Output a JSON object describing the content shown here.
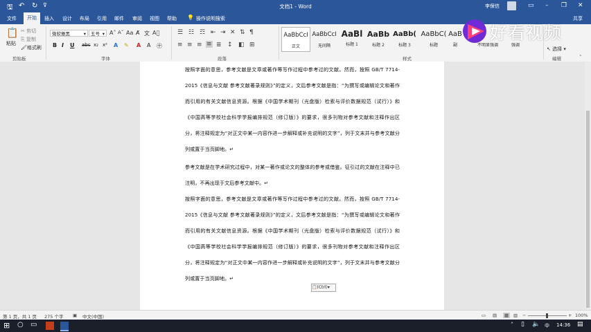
{
  "window": {
    "title": "文档1 - Word",
    "user": "李保信",
    "share": "共享"
  },
  "tabs": [
    "文件",
    "开始",
    "插入",
    "设计",
    "布局",
    "引用",
    "邮件",
    "审阅",
    "视图",
    "帮助"
  ],
  "tell_me": "操作说明搜索",
  "clipboard": {
    "paste": "粘贴",
    "cut": "剪切",
    "copy": "复制",
    "format_painter": "格式刷",
    "group": "剪贴板"
  },
  "font": {
    "name": "微软雅黑",
    "size": "五号",
    "group": "字体"
  },
  "paragraph": {
    "group": "段落"
  },
  "styles": {
    "items": [
      {
        "sample": "AaBbCcI",
        "name": "正文"
      },
      {
        "sample": "AaBbCcI",
        "name": "无间隔"
      },
      {
        "sample": "AaBl",
        "name": "标题 1"
      },
      {
        "sample": "AaBb",
        "name": "标题 2"
      },
      {
        "sample": "AaBb(",
        "name": "标题 3"
      },
      {
        "sample": "AaBbC(",
        "name": "标题"
      },
      {
        "sample": "AaB",
        "name": "副"
      },
      {
        "sample": "",
        "name": "不明显强调"
      },
      {
        "sample": "",
        "name": "强调"
      }
    ],
    "group": "样式"
  },
  "editing": {
    "select": "选择",
    "group": "编辑"
  },
  "document": {
    "paragraphs": [
      "按照字面的意思，参考文献是文章或著作等写作过程中参考过的文献。然而，按照 GB/T 7714-2015《信息与文献 参考文献著录规则》”的定义，文后参考文献是指：“为撰写或编辑论文和著作而引用的有关文献信息资源。根据《中国学术期刊（光盘版）检索与评价数据规范（试行）》和《中国高等学校社会科学学报编排规范（修订版）》的要求，很多刊物对参考文献和注释作出区分，将注释规定为“对正文中某一内容作进一步解释或补充说明的文字”，列于文末并与参考文献分列或置于当页脚地。↵",
      "参考文献是在学术研究过程中，对某一著作或论文的整体的参考或借鉴。征引过的文献在注释中已注明，不再出现于文后参考文献中。↵",
      "按照字面的意思，参考文献是文章或著作等写作过程中参考过的文献。然而，按照 GB/T 7714-2015《信息与文献 参考文献著录规则》”的定义，文后参考文献是指：“为撰写或编辑论文和著作而引用的有关文献信息资源。根据《中国学术期刊（光盘版）检索与评价数据规范（试行）》和《中国高等学校社会科学学报编排规范（修订版）》的要求，很多刊物对参考文献和注释作出区分，将注释规定为“对正文中某一内容作进一步解释或补充说明的文字”，列于文末并与参考文献分列或置于当页脚地。↵"
    ],
    "paste_options": "(Ctrl)"
  },
  "status": {
    "page": "第 1 页，共 1 页",
    "words": "275 个字",
    "language": "中文(中国)",
    "zoom": "100%"
  },
  "taskbar": {
    "ime": "中",
    "time": "14:36"
  },
  "watermark": {
    "text": "好看视频"
  },
  "colors": {
    "title_bar": "#2b579a",
    "ribbon": "#f3f3f3",
    "taskbar": "#1b1f2a"
  }
}
